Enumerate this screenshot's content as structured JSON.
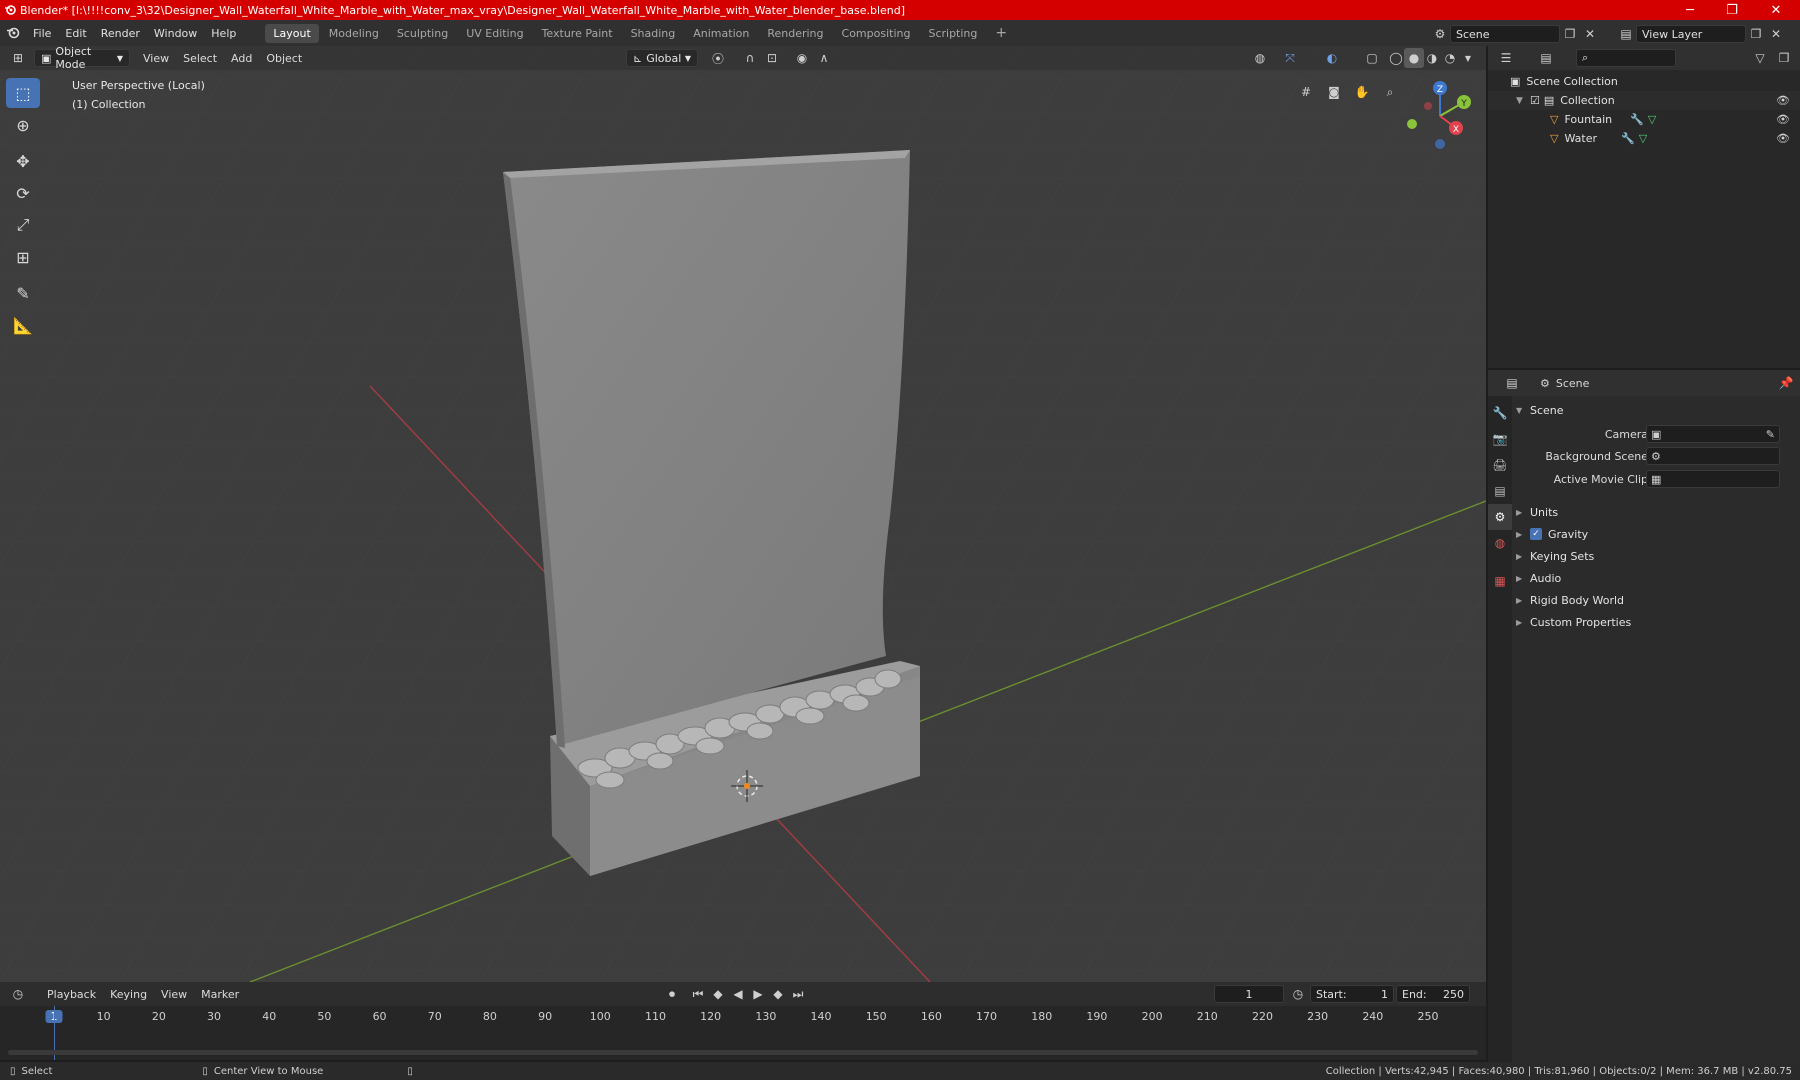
{
  "window": {
    "title": "Blender* [I:\\!!!!conv_3\\32\\Designer_Wall_Waterfall_White_Marble_with_Water_max_vray\\Designer_Wall_Waterfall_White_Marble_with_Water_blender_base.blend]",
    "minimize": "─",
    "maximize": "❐",
    "close": "✕"
  },
  "menu": [
    "File",
    "Edit",
    "Render",
    "Window",
    "Help"
  ],
  "workspaces": [
    {
      "label": "Layout",
      "active": true
    },
    {
      "label": "Modeling"
    },
    {
      "label": "Sculpting"
    },
    {
      "label": "UV Editing"
    },
    {
      "label": "Texture Paint"
    },
    {
      "label": "Shading"
    },
    {
      "label": "Animation"
    },
    {
      "label": "Rendering"
    },
    {
      "label": "Compositing"
    },
    {
      "label": "Scripting"
    }
  ],
  "scene_field": "Scene",
  "view_layer_field": "View Layer",
  "viewport": {
    "mode": "Object Mode",
    "menus": [
      "View",
      "Select",
      "Add",
      "Object"
    ],
    "orientation": "Global",
    "info_line1": "User Perspective (Local)",
    "info_line2": "(1) Collection",
    "gizmo": {
      "x": "X",
      "y": "Y",
      "z": "Z"
    }
  },
  "outliner": {
    "rows": [
      {
        "label": "Scene Collection"
      },
      {
        "label": "Collection"
      },
      {
        "label": "Fountain"
      },
      {
        "label": "Water"
      }
    ]
  },
  "properties": {
    "header": "Scene",
    "panel": "Scene",
    "camera_label": "Camera",
    "bg_scene_label": "Background Scene",
    "movie_clip_label": "Active Movie Clip",
    "subpanels": [
      "Units",
      "Gravity",
      "Keying Sets",
      "Audio",
      "Rigid Body World",
      "Custom Properties"
    ]
  },
  "timeline": {
    "menus": [
      "Playback",
      "Keying",
      "View",
      "Marker"
    ],
    "current_frame": "1",
    "start_label": "Start:",
    "start": "1",
    "end_label": "End:",
    "end": "250",
    "ruler": [
      "1",
      "10",
      "20",
      "30",
      "40",
      "50",
      "60",
      "70",
      "80",
      "90",
      "100",
      "110",
      "120",
      "130",
      "140",
      "150",
      "160",
      "170",
      "180",
      "190",
      "200",
      "210",
      "220",
      "230",
      "240",
      "250"
    ]
  },
  "status": {
    "left_action": "Select",
    "mid_action": "Center View to Mouse",
    "right": "Collection | Verts:42,945 | Faces:40,980 | Tris:81,960 | Objects:0/2 | Mem: 36.7 MB | v2.80.75"
  },
  "colors": {
    "titlebar": "#d40000",
    "accent": "#4772b3",
    "axis_x": "#e0434d",
    "axis_y": "#8ac43a",
    "axis_z": "#3f78cf"
  }
}
